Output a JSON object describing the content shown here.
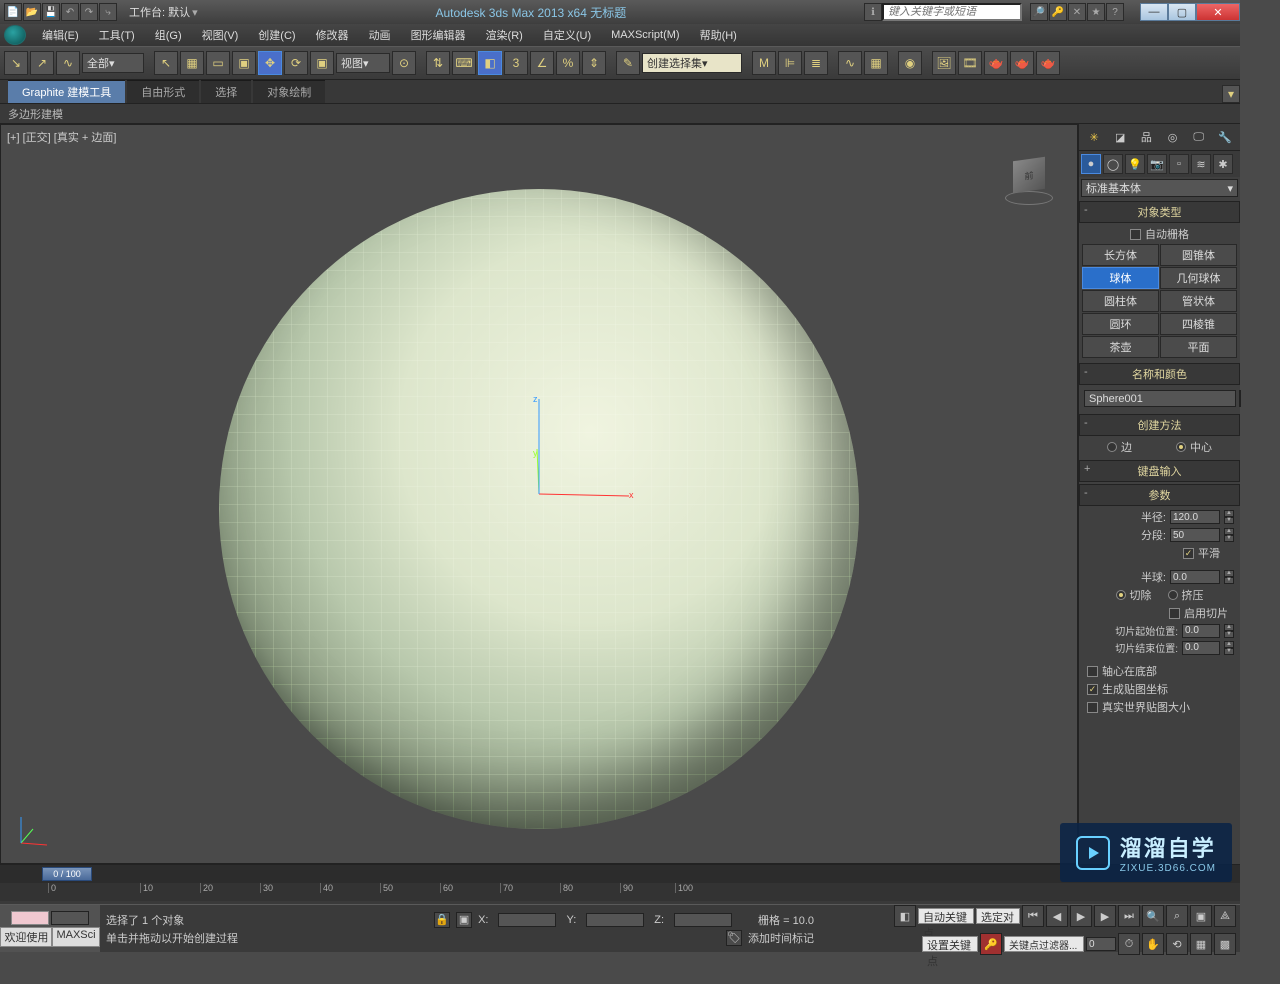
{
  "titlebar": {
    "workspace_label": "工作台: 默认",
    "title": "Autodesk 3ds Max  2013 x64    无标题",
    "search_placeholder": "键入关键字或短语"
  },
  "menu": [
    "编辑(E)",
    "工具(T)",
    "组(G)",
    "视图(V)",
    "创建(C)",
    "修改器",
    "动画",
    "图形编辑器",
    "渲染(R)",
    "自定义(U)",
    "MAXScript(M)",
    "帮助(H)"
  ],
  "toolbar": {
    "filter": "全部",
    "view_dd": "视图",
    "named_sel": "创建选择集"
  },
  "ribbon": {
    "tabs": [
      "Graphite 建模工具",
      "自由形式",
      "选择",
      "对象绘制"
    ],
    "subtab": "多边形建模"
  },
  "viewport": {
    "label": "[+] [正交] [真实 + 边面]",
    "cube_face": "前",
    "axes": {
      "x": "x",
      "y": "y",
      "z": "z"
    }
  },
  "panel": {
    "category": "标准基本体",
    "rollouts": {
      "object_type": {
        "title": "对象类型",
        "autogrid": "自动栅格"
      },
      "name_color": {
        "title": "名称和颜色",
        "name": "Sphere001"
      },
      "creation": {
        "title": "创建方法",
        "edge": "边",
        "center": "中心"
      },
      "keyboard": {
        "title": "键盘输入"
      },
      "params": {
        "title": "参数",
        "radius": "半径:",
        "radius_v": "120.0",
        "segs": "分段:",
        "segs_v": "50",
        "smooth": "平滑",
        "hemi": "半球:",
        "hemi_v": "0.0",
        "chop": "切除",
        "squash": "挤压",
        "slice_on": "启用切片",
        "slice_from": "切片起始位置:",
        "slice_from_v": "0.0",
        "slice_to": "切片结束位置:",
        "slice_to_v": "0.0",
        "pivot_bottom": "轴心在底部",
        "gen_uv": "生成贴图坐标",
        "real_world": "真实世界贴图大小"
      }
    },
    "objects": [
      "长方体",
      "圆锥体",
      "球体",
      "几何球体",
      "圆柱体",
      "管状体",
      "圆环",
      "四棱锥",
      "茶壶",
      "平面"
    ]
  },
  "timeline": {
    "frame": "0 / 100",
    "ticks": [
      "0",
      "10",
      "20",
      "30",
      "40",
      "50",
      "60",
      "70",
      "80",
      "90",
      "100"
    ],
    "marks": [
      140,
      200,
      260,
      320,
      380,
      440,
      500,
      560,
      620,
      675
    ]
  },
  "status": {
    "welcome": "欢迎使用",
    "script": "MAXSci",
    "sel": "选择了 1 个对象",
    "hint": "单击并拖动以开始创建过程",
    "x": "X:",
    "y": "Y:",
    "z": "Z:",
    "grid": "栅格 = 10.0",
    "add_marker": "添加时间标记",
    "autokey": "自动关键点",
    "setkey": "设置关键点",
    "selected": "选定对",
    "keyfilter": "关键点过滤器..."
  },
  "watermark": {
    "big": "溜溜自学",
    "small": "ZIXUE.3D66.COM"
  }
}
